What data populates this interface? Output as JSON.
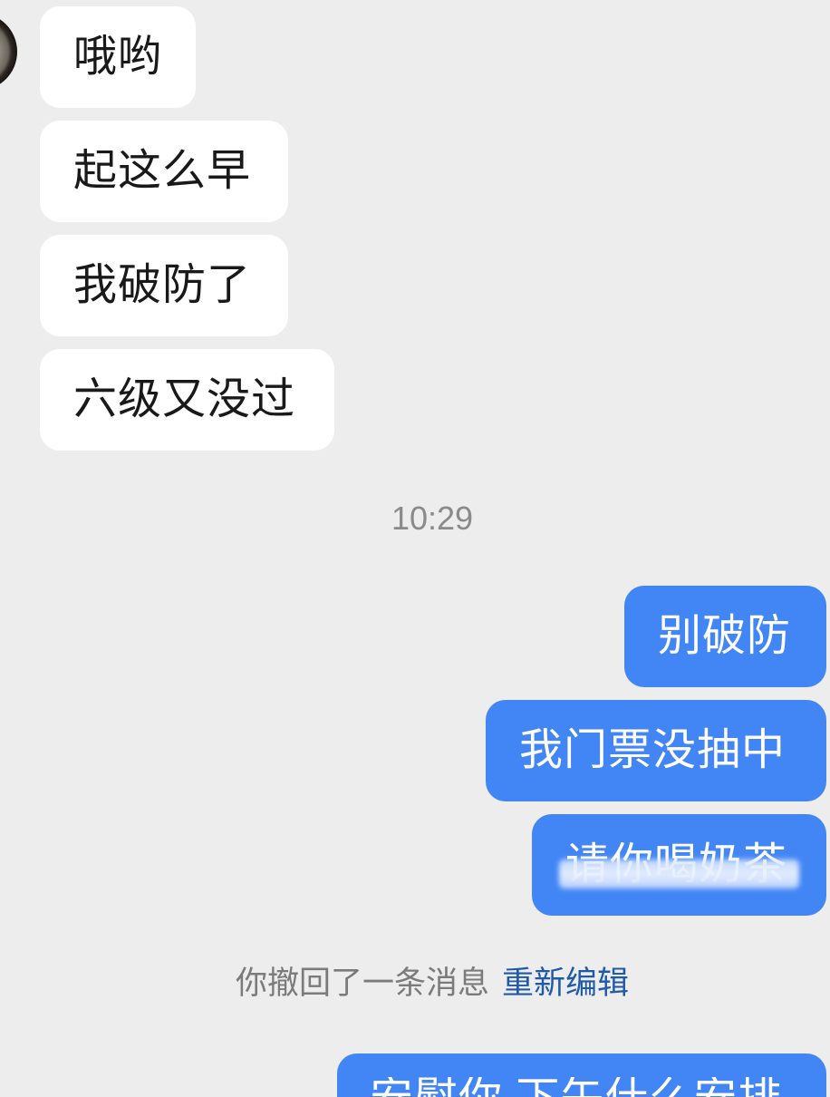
{
  "colors": {
    "background": "#ededed",
    "received-bubble": "#ffffff",
    "received-text": "#191919",
    "sent-bubble": "#4286f5",
    "sent-text": "#ffffff",
    "timestamp-text": "#8a8a8a",
    "notice-text": "#7b7b7b",
    "link": "#1f5aa8"
  },
  "chat": {
    "received": [
      "哦哟",
      "起这么早",
      "我破防了",
      "六级又没过"
    ],
    "time_divider": "10:29",
    "sent": [
      "别破防",
      "我门票没抽中",
      "请你喝奶茶"
    ],
    "recall_notice": "你撤回了一条消息",
    "recall_action": "重新编辑",
    "sent_latest": "安慰你 下午什么安排"
  }
}
